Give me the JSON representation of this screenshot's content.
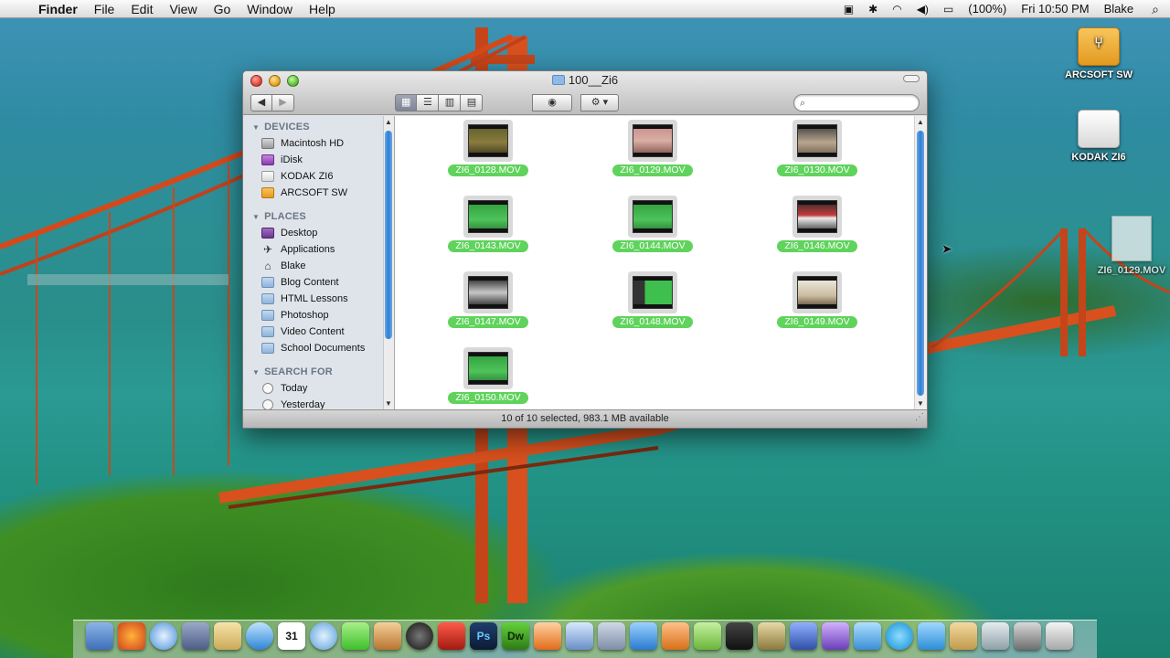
{
  "menubar": {
    "app_name": "Finder",
    "menus": [
      "File",
      "Edit",
      "View",
      "Go",
      "Window",
      "Help"
    ],
    "battery": "(100%)",
    "clock": "Fri 10:50 PM",
    "user": "Blake"
  },
  "desktop": {
    "icons": [
      {
        "label": "ARCSOFT SW",
        "icon": "usb-drive-icon"
      },
      {
        "label": "KODAK ZI6",
        "icon": "drive-icon"
      },
      {
        "label": "ZI6_0129.MOV",
        "icon": "document-icon"
      }
    ]
  },
  "window": {
    "title": "100__Zi6",
    "search_placeholder": "",
    "sidebar": {
      "devices_header": "DEVICES",
      "devices": [
        "Macintosh HD",
        "iDisk",
        "KODAK ZI6",
        "ARCSOFT SW"
      ],
      "places_header": "PLACES",
      "places": [
        "Desktop",
        "Applications",
        "Blake",
        "Blog Content",
        "HTML Lessons",
        "Photoshop",
        "Video Content",
        "School Documents"
      ],
      "search_header": "SEARCH FOR",
      "searches": [
        "Today",
        "Yesterday"
      ]
    },
    "files": [
      {
        "name": "ZI6_0128.MOV",
        "thumb": "office"
      },
      {
        "name": "ZI6_0129.MOV",
        "thumb": "pink"
      },
      {
        "name": "ZI6_0130.MOV",
        "thumb": "cat"
      },
      {
        "name": "ZI6_0143.MOV",
        "thumb": "green"
      },
      {
        "name": "ZI6_0144.MOV",
        "thumb": "green"
      },
      {
        "name": "ZI6_0146.MOV",
        "thumb": "screen"
      },
      {
        "name": "ZI6_0147.MOV",
        "thumb": "dark"
      },
      {
        "name": "ZI6_0148.MOV",
        "thumb": "greenface"
      },
      {
        "name": "ZI6_0149.MOV",
        "thumb": "light"
      },
      {
        "name": "ZI6_0150.MOV",
        "thumb": "green"
      }
    ],
    "status": "10 of 10 selected, 983.1 MB available"
  },
  "dock": {
    "labels": [
      "Ps",
      "Dw",
      "31"
    ]
  },
  "colors": {
    "selection_label": "#5fd35c",
    "scroll_thumb": "#2e7fd3"
  }
}
